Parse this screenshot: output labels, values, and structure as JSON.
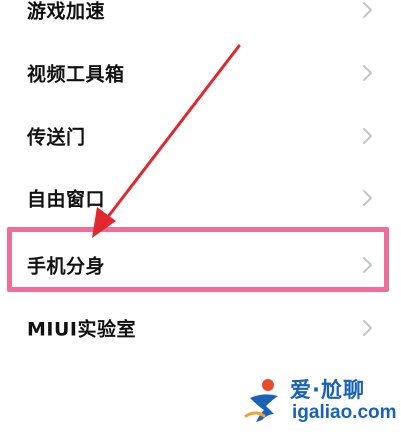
{
  "settings": {
    "items": [
      {
        "label": "游戏加速"
      },
      {
        "label": "视频工具箱"
      },
      {
        "label": "传送门"
      },
      {
        "label": "自由窗口"
      },
      {
        "label": "手机分身"
      },
      {
        "label": "MIUI实验室"
      }
    ]
  },
  "watermark": {
    "title": "爱·尬聊",
    "url": "igaliao.com"
  },
  "colors": {
    "highlight": "#ec6f9a",
    "arrow": "#e0282e",
    "chevron": "#c4c4c4",
    "watermark": "#1a62b7"
  }
}
